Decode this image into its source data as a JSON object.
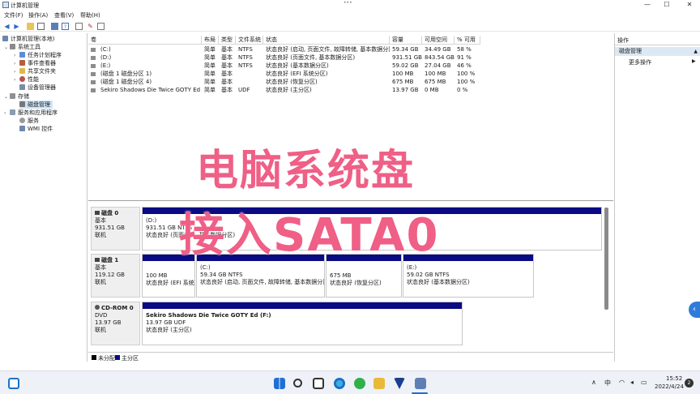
{
  "window": {
    "title": "计算机管理",
    "minimize": "—",
    "maximize": "☐",
    "close": "✕"
  },
  "top_right_more": "•••",
  "menu": [
    "文件(F)",
    "操作(A)",
    "查看(V)",
    "帮助(H)"
  ],
  "toolbar_icons": [
    "back-arrow-icon",
    "forward-arrow-icon",
    "up-folder-icon",
    "show-tree-icon",
    "properties-icon",
    "help-icon",
    "help-book-icon",
    "settings-icon",
    "panel-icon"
  ],
  "tree": [
    {
      "label": "计算机管理(本地)",
      "indent": 0,
      "arrow": ""
    },
    {
      "label": "系统工具",
      "indent": 1,
      "arrow": "⌄"
    },
    {
      "label": "任务计划程序",
      "indent": 2,
      "arrow": "›"
    },
    {
      "label": "事件查看器",
      "indent": 2,
      "arrow": "›"
    },
    {
      "label": "共享文件夹",
      "indent": 2,
      "arrow": "›"
    },
    {
      "label": "性能",
      "indent": 2,
      "arrow": "›"
    },
    {
      "label": "设备管理器",
      "indent": 2,
      "arrow": ""
    },
    {
      "label": "存储",
      "indent": 1,
      "arrow": "⌄"
    },
    {
      "label": "磁盘管理",
      "indent": 2,
      "arrow": "",
      "selected": true
    },
    {
      "label": "服务和应用程序",
      "indent": 1,
      "arrow": "›"
    },
    {
      "label": "服务",
      "indent": 2,
      "arrow": ""
    },
    {
      "label": "WMI 控件",
      "indent": 2,
      "arrow": ""
    }
  ],
  "volume_table": {
    "headers": [
      "卷",
      "布局",
      "类型",
      "文件系统",
      "状态",
      "容量",
      "可用空间",
      "% 可用"
    ],
    "rows": [
      [
        "(C:)",
        "简单",
        "基本",
        "NTFS",
        "状态良好 (启动, 页面文件, 故障转储, 基本数据分区)",
        "59.34 GB",
        "34.49 GB",
        "58 %"
      ],
      [
        "(D:)",
        "简单",
        "基本",
        "NTFS",
        "状态良好 (页面文件, 基本数据分区)",
        "931.51 GB",
        "843.54 GB",
        "91 %"
      ],
      [
        "(E:)",
        "简单",
        "基本",
        "NTFS",
        "状态良好 (基本数据分区)",
        "59.02 GB",
        "27.04 GB",
        "46 %"
      ],
      [
        "(磁盘 1 磁盘分区 1)",
        "简单",
        "基本",
        "",
        "状态良好 (EFI 系统分区)",
        "100 MB",
        "100 MB",
        "100 %"
      ],
      [
        "(磁盘 1 磁盘分区 4)",
        "简单",
        "基本",
        "",
        "状态良好 (恢复分区)",
        "675 MB",
        "675 MB",
        "100 %"
      ],
      [
        "Sekiro Shadows Die Twice GOTY Ed (F:)",
        "简单",
        "基本",
        "UDF",
        "状态良好 (主分区)",
        "13.97 GB",
        "0 MB",
        "0 %"
      ]
    ]
  },
  "disks": [
    {
      "name": "磁盘 0",
      "kind": "基本",
      "size": "931.51 GB",
      "state": "联机",
      "partitions": [
        {
          "label": "(D:)",
          "line1": "931.51 GB NTFS",
          "line2": "状态良好 (页面文件, 基本数据分区)"
        }
      ]
    },
    {
      "name": "磁盘 1",
      "kind": "基本",
      "size": "119.12 GB",
      "state": "联机",
      "partitions": [
        {
          "label": "",
          "line1": "100 MB",
          "line2": "状态良好 (EFI 系统分"
        },
        {
          "label": "(C:)",
          "line1": "59.34 GB NTFS",
          "line2": "状态良好 (启动, 页面文件, 故障转储, 基本数据分区)"
        },
        {
          "label": "",
          "line1": "675 MB",
          "line2": "状态良好 (恢复分区)"
        },
        {
          "label": "(E:)",
          "line1": "59.02 GB NTFS",
          "line2": "状态良好 (基本数据分区)"
        }
      ]
    },
    {
      "name": "CD-ROM 0",
      "kind": "DVD",
      "size": "13.97 GB",
      "state": "联机",
      "partitions": [
        {
          "label": "Sekiro Shadows Die Twice GOTY Ed  (F:)",
          "line1": "13.97 GB UDF",
          "line2": "状态良好 (主分区)"
        }
      ]
    }
  ],
  "legend": [
    {
      "label": "未分配",
      "color": "#000000"
    },
    {
      "label": "主分区",
      "color": "#0a0a82"
    }
  ],
  "actions": {
    "header": "操作",
    "section": "磁盘管理",
    "more": "更多操作",
    "section_arrow": "▲",
    "more_arrow": "▶"
  },
  "overlay": {
    "line1": "电脑系统盘",
    "line2": "接入SATA0",
    "color": "#ef5f86"
  },
  "taskbar": {
    "time": "15:52",
    "date": "2022/4/24",
    "ime": "中",
    "notification_count": "2",
    "tray_up": "∧"
  },
  "colors": {
    "partition_bar": "#0a0a82",
    "selection": "#cce4f7",
    "accent": "#2f7cd9"
  }
}
